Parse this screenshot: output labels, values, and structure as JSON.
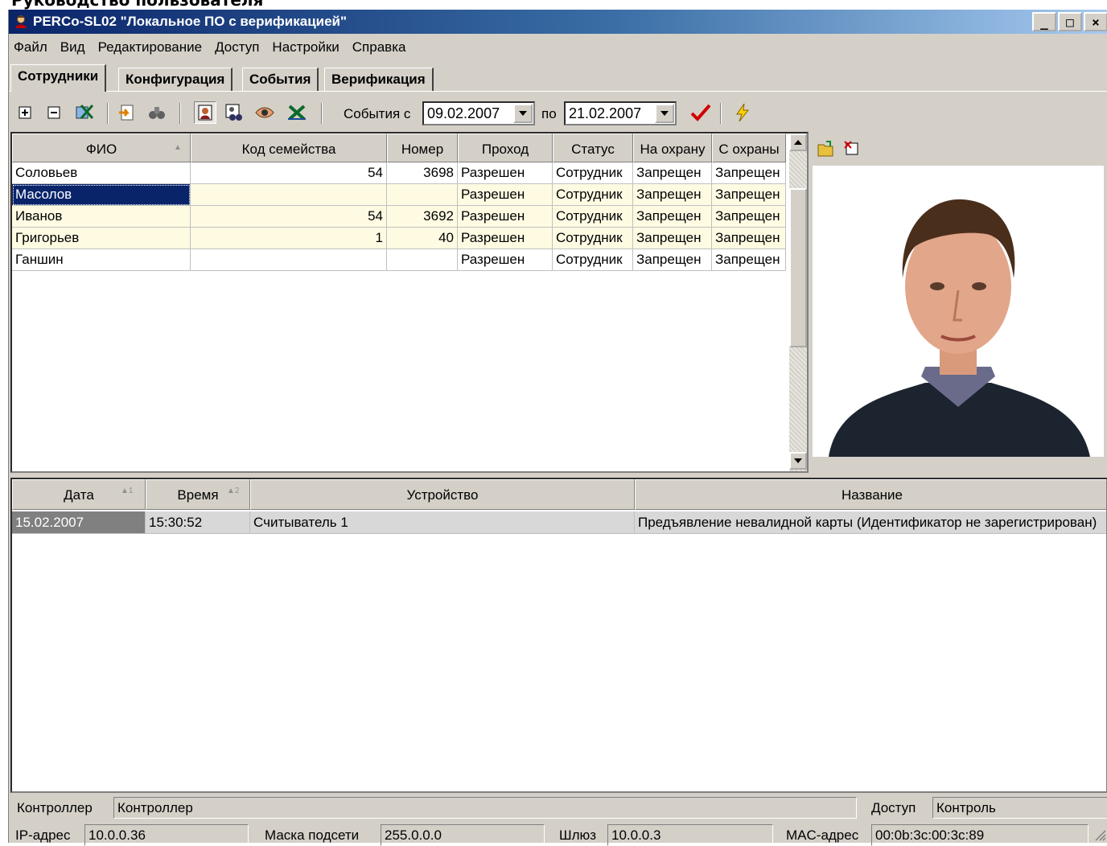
{
  "document_header": "Руководство пользователя",
  "window": {
    "title": "PERCo-SL02 \"Локальное ПО с верификацией\"",
    "controls": [
      "_",
      "□",
      "×"
    ]
  },
  "menu": [
    "Файл",
    "Вид",
    "Редактирование",
    "Доступ",
    "Настройки",
    "Справка"
  ],
  "tabs": [
    {
      "label": "Сотрудники",
      "active": true
    },
    {
      "label": "Конфигурация",
      "active": false
    },
    {
      "label": "События",
      "active": false
    },
    {
      "label": "Верификация",
      "active": false
    }
  ],
  "toolbar": {
    "events_from_label": "События с",
    "date_from": "09.02.2007",
    "to_label": "по",
    "date_to": "21.02.2007"
  },
  "employees": {
    "columns": [
      "ФИО",
      "Код семейства",
      "Номер",
      "Проход",
      "Статус",
      "На охрану",
      "С охраны"
    ],
    "rows": [
      [
        "Соловьев",
        "54",
        "3698",
        "Разрешен",
        "Сотрудник",
        "Запрещен",
        "Запрещен"
      ],
      [
        "Масолов",
        "",
        "",
        "Разрешен",
        "Сотрудник",
        "Запрещен",
        "Запрещен"
      ],
      [
        "Иванов",
        "54",
        "3692",
        "Разрешен",
        "Сотрудник",
        "Запрещен",
        "Запрещен"
      ],
      [
        "Григорьев",
        "1",
        "40",
        "Разрешен",
        "Сотрудник",
        "Запрещен",
        "Запрещен"
      ],
      [
        "Ганшин",
        "",
        "",
        "Разрешен",
        "Сотрудник",
        "Запрещен",
        "Запрещен"
      ]
    ],
    "selected_row": 1
  },
  "events": {
    "columns": [
      "Дата",
      "Время",
      "Устройство",
      "Название"
    ],
    "sort_marks": [
      "1",
      "2"
    ],
    "rows": [
      [
        "15.02.2007",
        "15:30:52",
        "Считыватель 1",
        "Предъявление невалидной карты (Идентификатор не зарегистрирован)"
      ]
    ]
  },
  "status": {
    "controller_label": "Контроллер",
    "controller_value": "Контроллер",
    "access_label": "Доступ",
    "access_value": "Контроль",
    "ip_label": "IP-адрес",
    "ip_value": "10.0.0.36",
    "mask_label": "Маска подсети",
    "mask_value": "255.0.0.0",
    "gateway_label": "Шлюз",
    "gateway_value": "10.0.0.3",
    "mac_label": "MAC-адрес",
    "mac_value": "00:0b:3c:00:3c:89"
  }
}
